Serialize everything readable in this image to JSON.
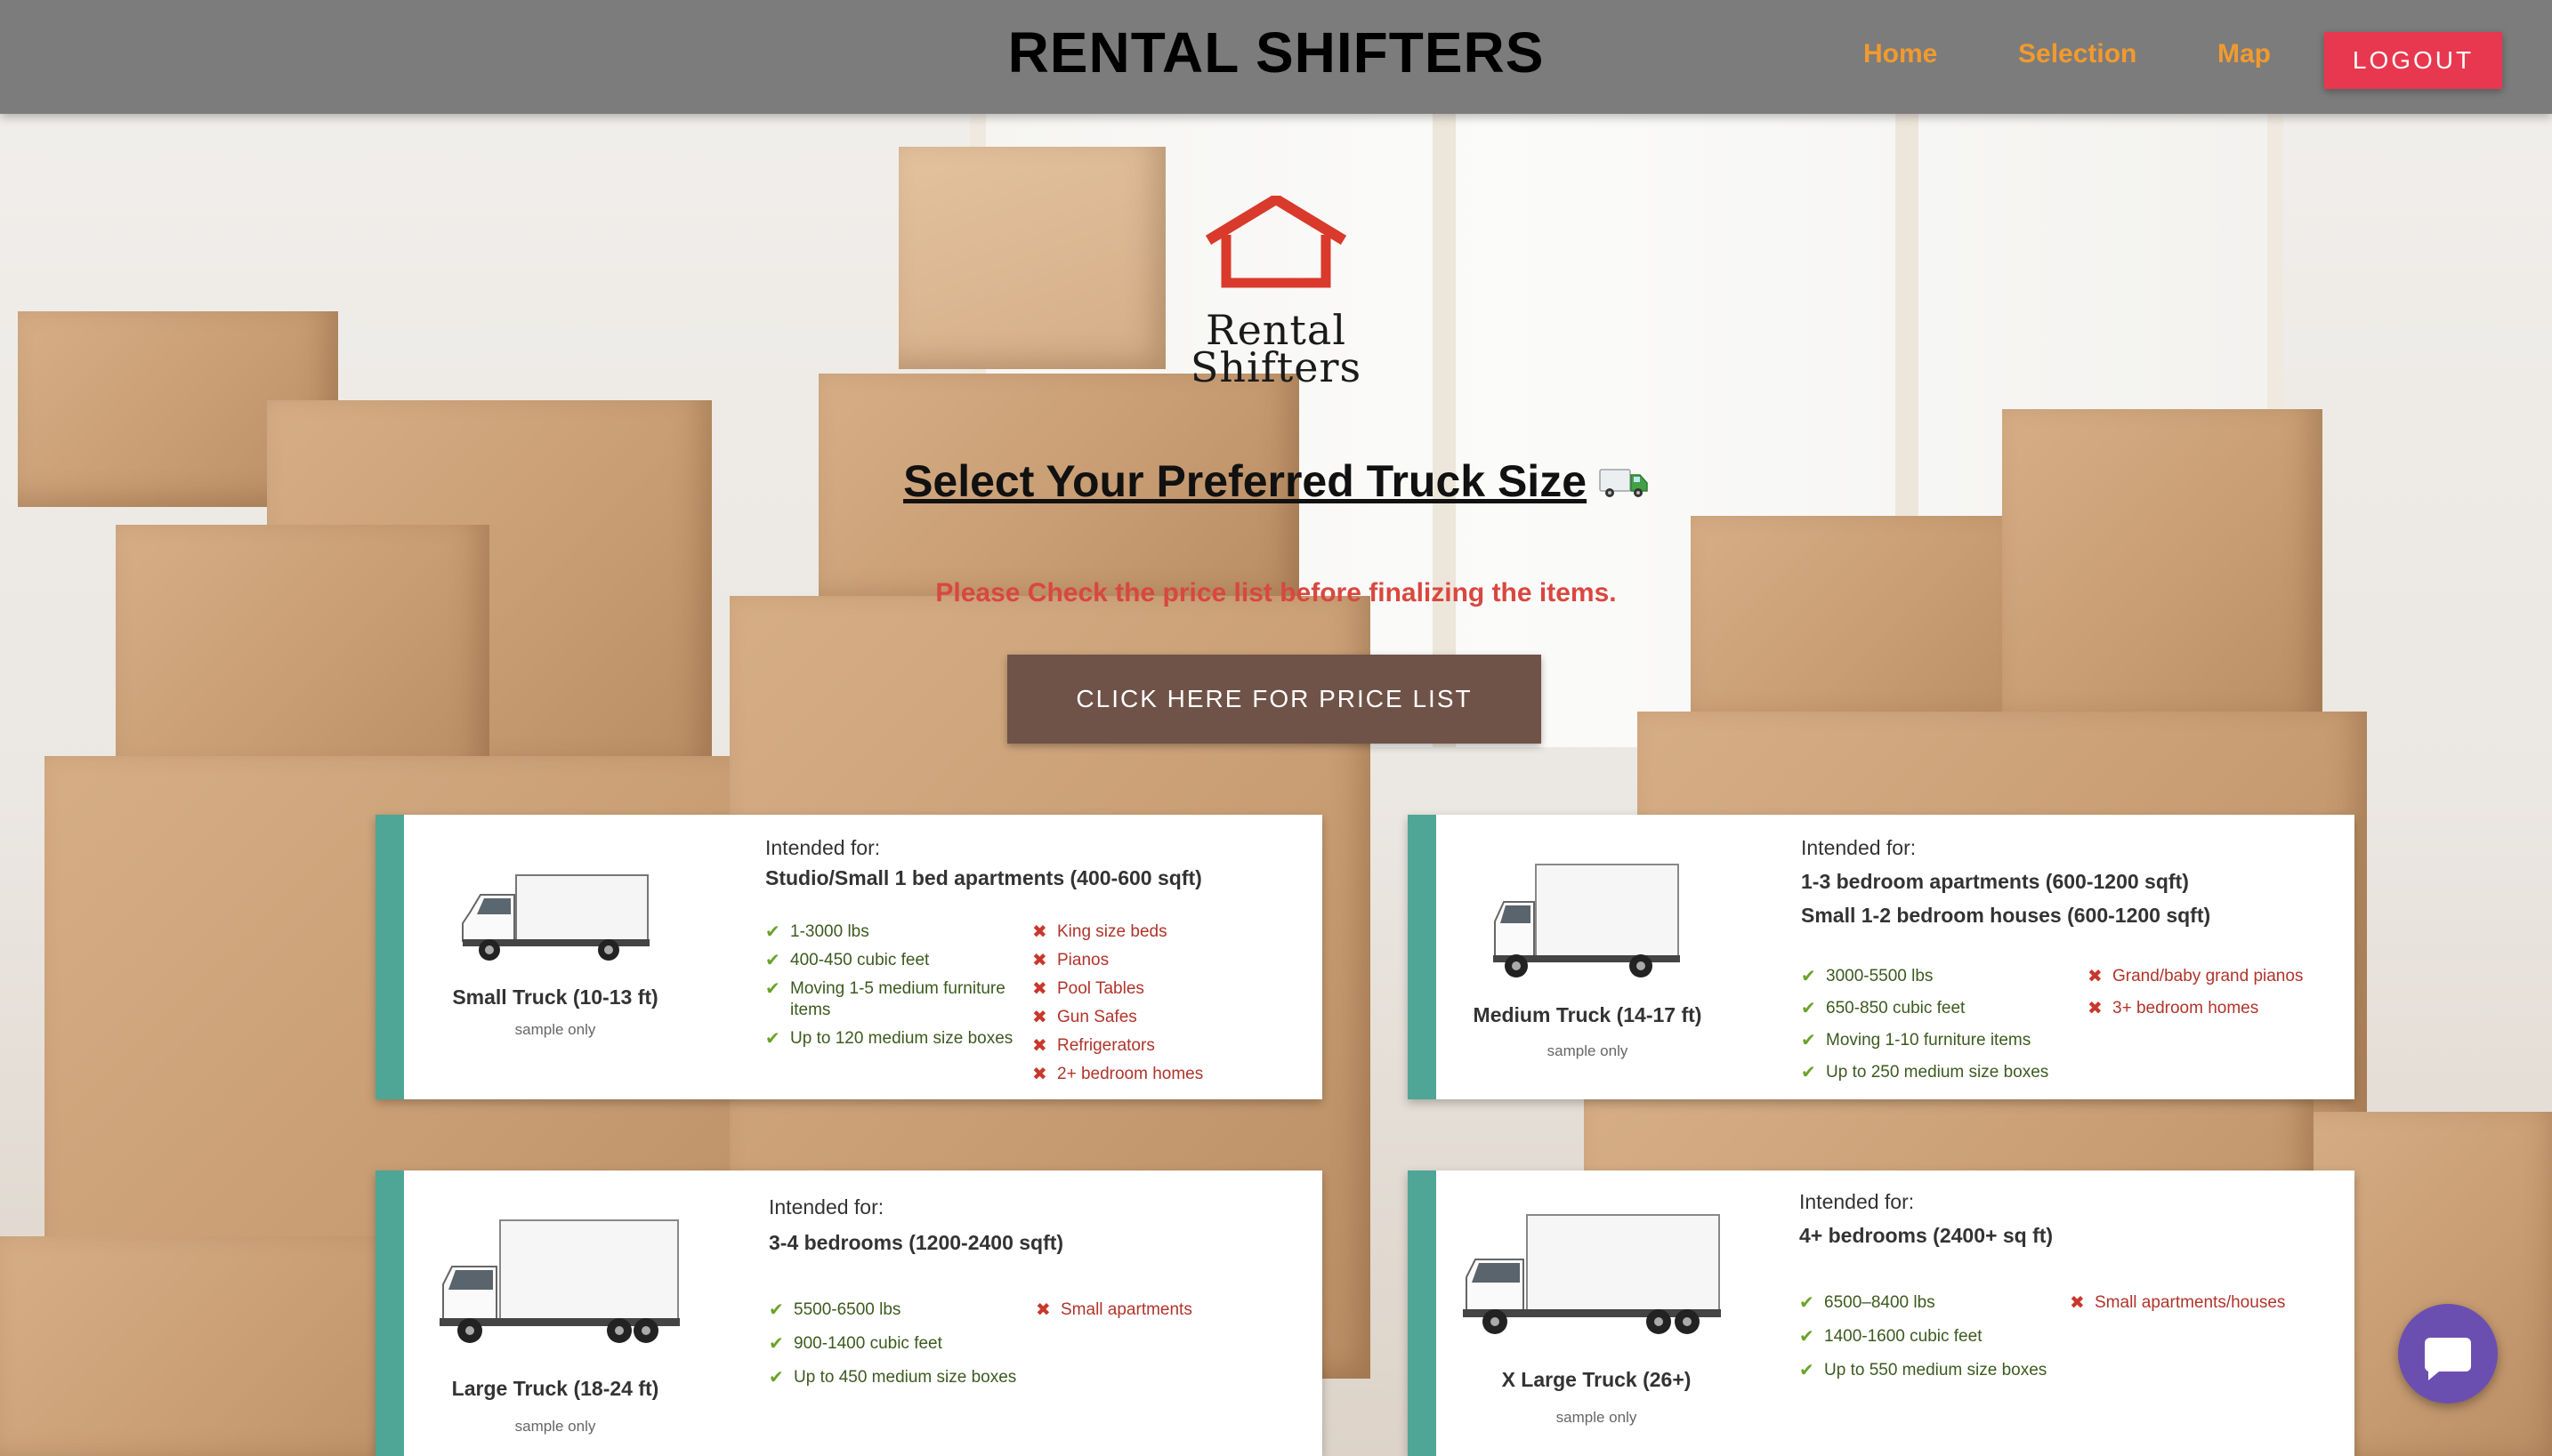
{
  "header": {
    "brand": "RENTAL SHIFTERS",
    "nav": [
      "Home",
      "Selection",
      "Map"
    ],
    "logout": "LOGOUT"
  },
  "logo": {
    "line1": "Rental",
    "line2": "Shifters"
  },
  "main": {
    "heading": "Select Your Preferred Truck Size",
    "note": "Please Check the price list before finalizing the items.",
    "price_button": "CLICK HERE FOR PRICE LIST"
  },
  "trucks": [
    {
      "name": "Small Truck (10-13 ft)",
      "sample": "sample only",
      "intended_label": "Intended for:",
      "intended_for": [
        "Studio/Small 1 bed apartments (400-600 sqft)"
      ],
      "features": [
        "1-3000 lbs",
        "400-450 cubic feet",
        "Moving 1-5 medium furniture items",
        "Up to 120 medium size boxes"
      ],
      "not_for": [
        "King size beds",
        "Pianos",
        "Pool Tables",
        "Gun Safes",
        "Refrigerators",
        "2+ bedroom homes"
      ]
    },
    {
      "name": "Medium Truck (14-17 ft)",
      "sample": "sample only",
      "intended_label": "Intended for:",
      "intended_for": [
        "1-3 bedroom apartments (600-1200 sqft)",
        "Small 1-2 bedroom houses (600-1200 sqft)"
      ],
      "features": [
        "3000-5500 lbs",
        "650-850 cubic feet",
        "Moving 1-10 furniture items",
        "Up to 250 medium size boxes"
      ],
      "not_for": [
        "Grand/baby grand pianos",
        "3+ bedroom homes"
      ]
    },
    {
      "name": "Large Truck (18-24 ft)",
      "sample": "sample only",
      "intended_label": "Intended for:",
      "intended_for": [
        "3-4 bedrooms (1200-2400 sqft)"
      ],
      "features": [
        "5500-6500 lbs",
        "900-1400 cubic feet",
        "Up to 450 medium size boxes"
      ],
      "not_for": [
        "Small apartments"
      ]
    },
    {
      "name": "X Large Truck (26+)",
      "sample": "sample only",
      "intended_label": "Intended for:",
      "intended_for": [
        "4+ bedrooms (2400+ sq ft)"
      ],
      "features": [
        "6500–8400 lbs",
        "1400-1600 cubic feet",
        "Up to 550 medium size boxes"
      ],
      "not_for": [
        "Small apartments/houses"
      ]
    }
  ],
  "icons": {
    "check": "check-icon",
    "cross": "cross-icon",
    "chat": "chat-icon",
    "truck": "truck-icon",
    "house": "house-icon"
  },
  "colors": {
    "header_bg": "#7c7c7c",
    "nav_link": "#f29a2e",
    "logout_bg": "#e8384f",
    "note": "#d9473f",
    "price_button_bg": "#6f5248",
    "card_accent": "#4fa596",
    "chat_bg": "#6b4fb0"
  }
}
